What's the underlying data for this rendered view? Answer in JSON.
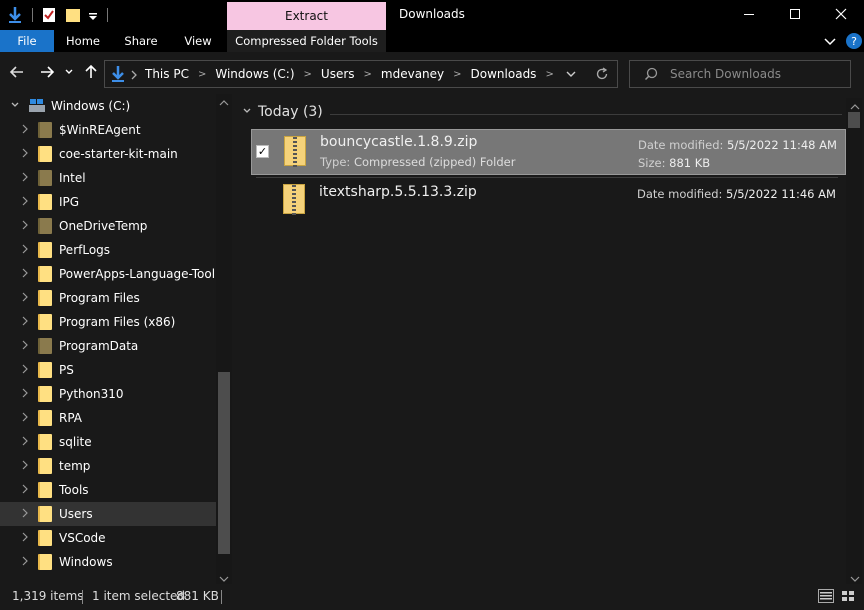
{
  "titlebar": {
    "window_title": "Downloads",
    "context_tab": "Extract",
    "controls": [
      "minimize-icon",
      "maximize-icon",
      "close-icon"
    ]
  },
  "ribbon": {
    "tabs": [
      {
        "label": "File"
      },
      {
        "label": "Home"
      },
      {
        "label": "Share"
      },
      {
        "label": "View"
      },
      {
        "label": "Compressed Folder Tools"
      }
    ]
  },
  "address": {
    "crumbs": [
      "This PC",
      "Windows (C:)",
      "Users",
      "mdevaney",
      "Downloads"
    ]
  },
  "search": {
    "placeholder": "Search Downloads"
  },
  "nav_pane": {
    "root": "Windows (C:)",
    "items": [
      {
        "label": "$WinREAgent",
        "style": "dim"
      },
      {
        "label": "coe-starter-kit-main",
        "style": "yellow"
      },
      {
        "label": "Intel",
        "style": "dim"
      },
      {
        "label": "IPG",
        "style": "yellow"
      },
      {
        "label": "OneDriveTemp",
        "style": "dim"
      },
      {
        "label": "PerfLogs",
        "style": "yellow"
      },
      {
        "label": "PowerApps-Language-Tooling",
        "style": "yellow"
      },
      {
        "label": "Program Files",
        "style": "yellow"
      },
      {
        "label": "Program Files (x86)",
        "style": "yellow"
      },
      {
        "label": "ProgramData",
        "style": "dim"
      },
      {
        "label": "PS",
        "style": "yellow"
      },
      {
        "label": "Python310",
        "style": "yellow"
      },
      {
        "label": "RPA",
        "style": "yellow"
      },
      {
        "label": "sqlite",
        "style": "yellow"
      },
      {
        "label": "temp",
        "style": "yellow"
      },
      {
        "label": "Tools",
        "style": "yellow"
      },
      {
        "label": "Users",
        "style": "yellow",
        "selected": true
      },
      {
        "label": "VSCode",
        "style": "yellow"
      },
      {
        "label": "Windows",
        "style": "yellow"
      }
    ]
  },
  "content": {
    "group_label": "Today (3)",
    "files": [
      {
        "name": "bouncycastle.1.8.9.zip",
        "type_label": "Type:",
        "type_value": "Compressed (zipped) Folder",
        "modified_label": "Date modified:",
        "modified_value": "5/5/2022 11:48 AM",
        "size_label": "Size:",
        "size_value": "881 KB",
        "selected": true
      },
      {
        "name": "itextsharp.5.5.13.3.zip",
        "modified_label": "Date modified:",
        "modified_value": "5/5/2022 11:46 AM",
        "selected": false
      }
    ]
  },
  "status": {
    "item_count": "1,319 items",
    "selection": "1 item selected",
    "selection_size": "881 KB"
  }
}
